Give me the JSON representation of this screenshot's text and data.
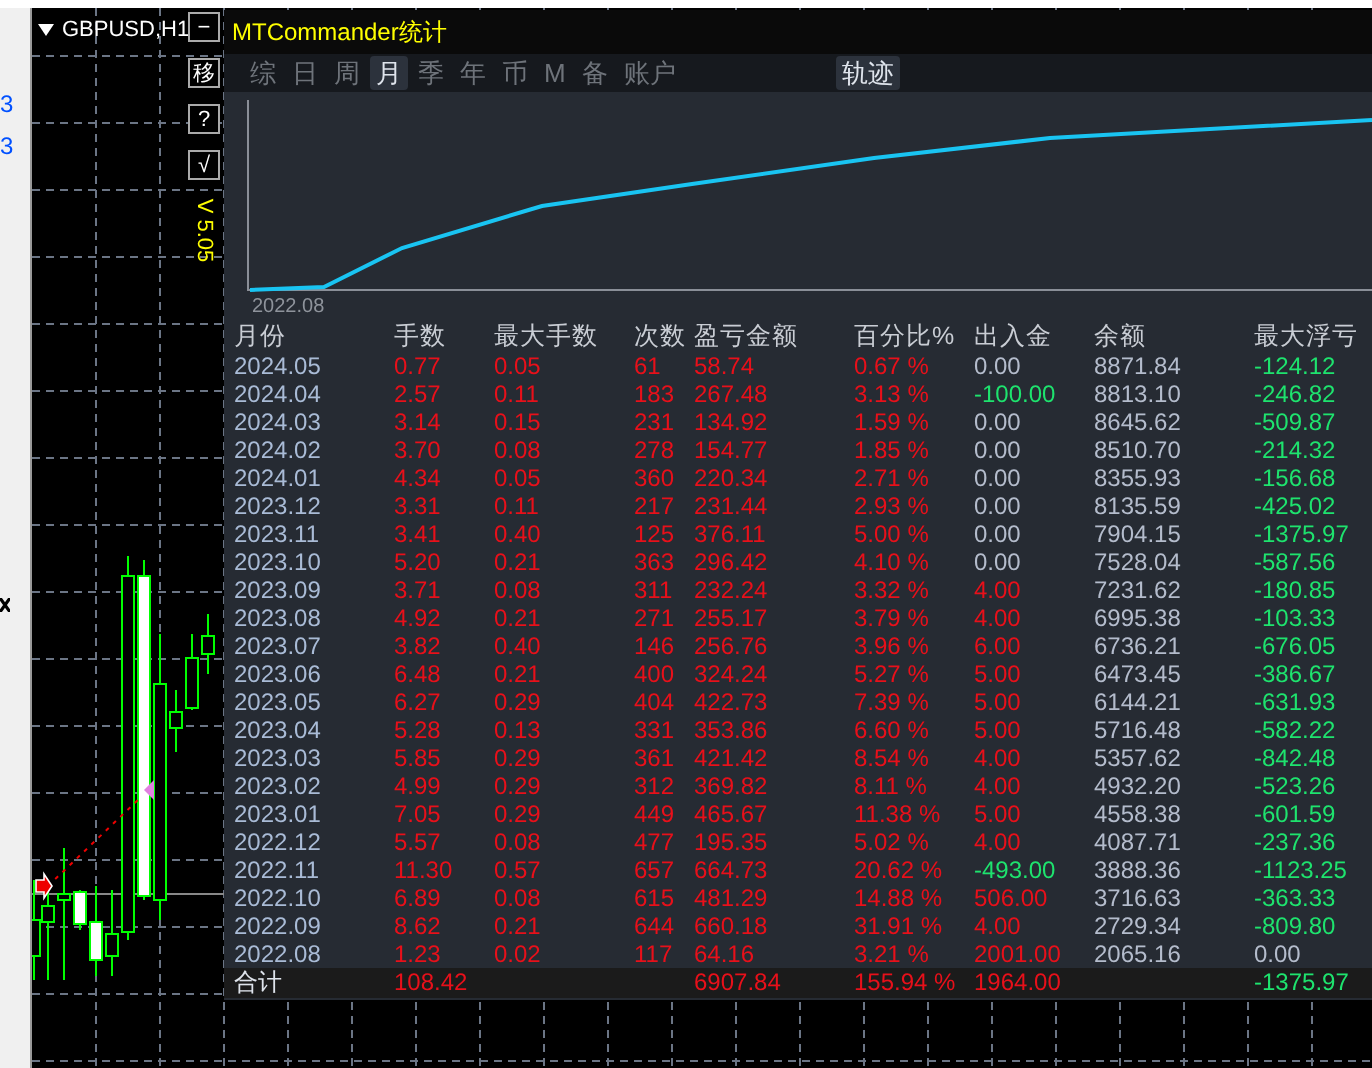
{
  "left_strip": {
    "values": [
      "3",
      "3"
    ]
  },
  "chart_window": {
    "title": "GBPUSD,H1",
    "buttons": [
      {
        "label": "−"
      },
      {
        "label": "移"
      },
      {
        "label": "?"
      },
      {
        "label": "√"
      }
    ],
    "version": "V 5.05"
  },
  "panel": {
    "title": "MTCommander统计",
    "tabs": [
      {
        "label": "综",
        "selected": false
      },
      {
        "label": "日",
        "selected": false
      },
      {
        "label": "周",
        "selected": false
      },
      {
        "label": "月",
        "selected": true
      },
      {
        "label": "季",
        "selected": false
      },
      {
        "label": "年",
        "selected": false
      },
      {
        "label": "币",
        "selected": false
      },
      {
        "label": "M",
        "selected": false
      },
      {
        "label": "备",
        "selected": false
      },
      {
        "label": "账户",
        "selected": false
      }
    ],
    "view_tab": {
      "label": "轨迹",
      "selected": true
    },
    "equity_chart": {
      "x_label": "2022.08"
    },
    "table": {
      "columns": [
        "月份",
        "手数",
        "最大手数",
        "次数",
        "盈亏金额",
        "百分比%",
        "出入金",
        "余额",
        "最大浮亏"
      ],
      "rows": [
        {
          "month": "2024.05",
          "lots": "0.77",
          "max_lots": "0.05",
          "trades": "61",
          "profit": "58.74",
          "percent": "0.67 %",
          "deposit": {
            "text": "0.00",
            "color": "#b4bccc"
          },
          "balance": "8871.84",
          "max_drawdown": {
            "text": "-124.12",
            "color": "#1ee36e"
          }
        },
        {
          "month": "2024.04",
          "lots": "2.57",
          "max_lots": "0.11",
          "trades": "183",
          "profit": "267.48",
          "percent": "3.13 %",
          "deposit": {
            "text": "-100.00",
            "color": "#1ee36e"
          },
          "balance": "8813.10",
          "max_drawdown": {
            "text": "-246.82",
            "color": "#1ee36e"
          }
        },
        {
          "month": "2024.03",
          "lots": "3.14",
          "max_lots": "0.15",
          "trades": "231",
          "profit": "134.92",
          "percent": "1.59 %",
          "deposit": {
            "text": "0.00",
            "color": "#b4bccc"
          },
          "balance": "8645.62",
          "max_drawdown": {
            "text": "-509.87",
            "color": "#1ee36e"
          }
        },
        {
          "month": "2024.02",
          "lots": "3.70",
          "max_lots": "0.08",
          "trades": "278",
          "profit": "154.77",
          "percent": "1.85 %",
          "deposit": {
            "text": "0.00",
            "color": "#b4bccc"
          },
          "balance": "8510.70",
          "max_drawdown": {
            "text": "-214.32",
            "color": "#1ee36e"
          }
        },
        {
          "month": "2024.01",
          "lots": "4.34",
          "max_lots": "0.05",
          "trades": "360",
          "profit": "220.34",
          "percent": "2.71 %",
          "deposit": {
            "text": "0.00",
            "color": "#b4bccc"
          },
          "balance": "8355.93",
          "max_drawdown": {
            "text": "-156.68",
            "color": "#1ee36e"
          }
        },
        {
          "month": "2023.12",
          "lots": "3.31",
          "max_lots": "0.11",
          "trades": "217",
          "profit": "231.44",
          "percent": "2.93 %",
          "deposit": {
            "text": "0.00",
            "color": "#b4bccc"
          },
          "balance": "8135.59",
          "max_drawdown": {
            "text": "-425.02",
            "color": "#1ee36e"
          }
        },
        {
          "month": "2023.11",
          "lots": "3.41",
          "max_lots": "0.40",
          "trades": "125",
          "profit": "376.11",
          "percent": "5.00 %",
          "deposit": {
            "text": "0.00",
            "color": "#b4bccc"
          },
          "balance": "7904.15",
          "max_drawdown": {
            "text": "-1375.97",
            "color": "#1ee36e"
          }
        },
        {
          "month": "2023.10",
          "lots": "5.20",
          "max_lots": "0.21",
          "trades": "363",
          "profit": "296.42",
          "percent": "4.10 %",
          "deposit": {
            "text": "0.00",
            "color": "#b4bccc"
          },
          "balance": "7528.04",
          "max_drawdown": {
            "text": "-587.56",
            "color": "#1ee36e"
          }
        },
        {
          "month": "2023.09",
          "lots": "3.71",
          "max_lots": "0.08",
          "trades": "311",
          "profit": "232.24",
          "percent": "3.32 %",
          "deposit": {
            "text": "4.00",
            "color": "#e8101a"
          },
          "balance": "7231.62",
          "max_drawdown": {
            "text": "-180.85",
            "color": "#1ee36e"
          }
        },
        {
          "month": "2023.08",
          "lots": "4.92",
          "max_lots": "0.21",
          "trades": "271",
          "profit": "255.17",
          "percent": "3.79 %",
          "deposit": {
            "text": "4.00",
            "color": "#e8101a"
          },
          "balance": "6995.38",
          "max_drawdown": {
            "text": "-103.33",
            "color": "#1ee36e"
          }
        },
        {
          "month": "2023.07",
          "lots": "3.82",
          "max_lots": "0.40",
          "trades": "146",
          "profit": "256.76",
          "percent": "3.96 %",
          "deposit": {
            "text": "6.00",
            "color": "#e8101a"
          },
          "balance": "6736.21",
          "max_drawdown": {
            "text": "-676.05",
            "color": "#1ee36e"
          }
        },
        {
          "month": "2023.06",
          "lots": "6.48",
          "max_lots": "0.21",
          "trades": "400",
          "profit": "324.24",
          "percent": "5.27 %",
          "deposit": {
            "text": "5.00",
            "color": "#e8101a"
          },
          "balance": "6473.45",
          "max_drawdown": {
            "text": "-386.67",
            "color": "#1ee36e"
          }
        },
        {
          "month": "2023.05",
          "lots": "6.27",
          "max_lots": "0.29",
          "trades": "404",
          "profit": "422.73",
          "percent": "7.39 %",
          "deposit": {
            "text": "5.00",
            "color": "#e8101a"
          },
          "balance": "6144.21",
          "max_drawdown": {
            "text": "-631.93",
            "color": "#1ee36e"
          }
        },
        {
          "month": "2023.04",
          "lots": "5.28",
          "max_lots": "0.13",
          "trades": "331",
          "profit": "353.86",
          "percent": "6.60 %",
          "deposit": {
            "text": "5.00",
            "color": "#e8101a"
          },
          "balance": "5716.48",
          "max_drawdown": {
            "text": "-582.22",
            "color": "#1ee36e"
          }
        },
        {
          "month": "2023.03",
          "lots": "5.85",
          "max_lots": "0.29",
          "trades": "361",
          "profit": "421.42",
          "percent": "8.54 %",
          "deposit": {
            "text": "4.00",
            "color": "#e8101a"
          },
          "balance": "5357.62",
          "max_drawdown": {
            "text": "-842.48",
            "color": "#1ee36e"
          }
        },
        {
          "month": "2023.02",
          "lots": "4.99",
          "max_lots": "0.29",
          "trades": "312",
          "profit": "369.82",
          "percent": "8.11 %",
          "deposit": {
            "text": "4.00",
            "color": "#e8101a"
          },
          "balance": "4932.20",
          "max_drawdown": {
            "text": "-523.26",
            "color": "#1ee36e"
          }
        },
        {
          "month": "2023.01",
          "lots": "7.05",
          "max_lots": "0.29",
          "trades": "449",
          "profit": "465.67",
          "percent": "11.38 %",
          "deposit": {
            "text": "5.00",
            "color": "#e8101a"
          },
          "balance": "4558.38",
          "max_drawdown": {
            "text": "-601.59",
            "color": "#1ee36e"
          }
        },
        {
          "month": "2022.12",
          "lots": "5.57",
          "max_lots": "0.08",
          "trades": "477",
          "profit": "195.35",
          "percent": "5.02 %",
          "deposit": {
            "text": "4.00",
            "color": "#e8101a"
          },
          "balance": "4087.71",
          "max_drawdown": {
            "text": "-237.36",
            "color": "#1ee36e"
          }
        },
        {
          "month": "2022.11",
          "lots": "11.30",
          "max_lots": "0.57",
          "trades": "657",
          "profit": "664.73",
          "percent": "20.62 %",
          "deposit": {
            "text": "-493.00",
            "color": "#1ee36e"
          },
          "balance": "3888.36",
          "max_drawdown": {
            "text": "-1123.25",
            "color": "#1ee36e"
          }
        },
        {
          "month": "2022.10",
          "lots": "6.89",
          "max_lots": "0.08",
          "trades": "615",
          "profit": "481.29",
          "percent": "14.88 %",
          "deposit": {
            "text": "506.00",
            "color": "#e8101a"
          },
          "balance": "3716.63",
          "max_drawdown": {
            "text": "-363.33",
            "color": "#1ee36e"
          }
        },
        {
          "month": "2022.09",
          "lots": "8.62",
          "max_lots": "0.21",
          "trades": "644",
          "profit": "660.18",
          "percent": "31.91 %",
          "deposit": {
            "text": "4.00",
            "color": "#e8101a"
          },
          "balance": "2729.34",
          "max_drawdown": {
            "text": "-809.80",
            "color": "#1ee36e"
          }
        },
        {
          "month": "2022.08",
          "lots": "1.23",
          "max_lots": "0.02",
          "trades": "117",
          "profit": "64.16",
          "percent": "3.21 %",
          "deposit": {
            "text": "2001.00",
            "color": "#e8101a"
          },
          "balance": "2065.16",
          "max_drawdown": {
            "text": "0.00",
            "color": "#b4bccc"
          }
        }
      ],
      "total": {
        "label": "合计",
        "lots": "108.42",
        "profit": "6907.84",
        "percent": "155.94 %",
        "deposit": "1964.00",
        "max_drawdown": "-1375.97"
      }
    }
  }
}
